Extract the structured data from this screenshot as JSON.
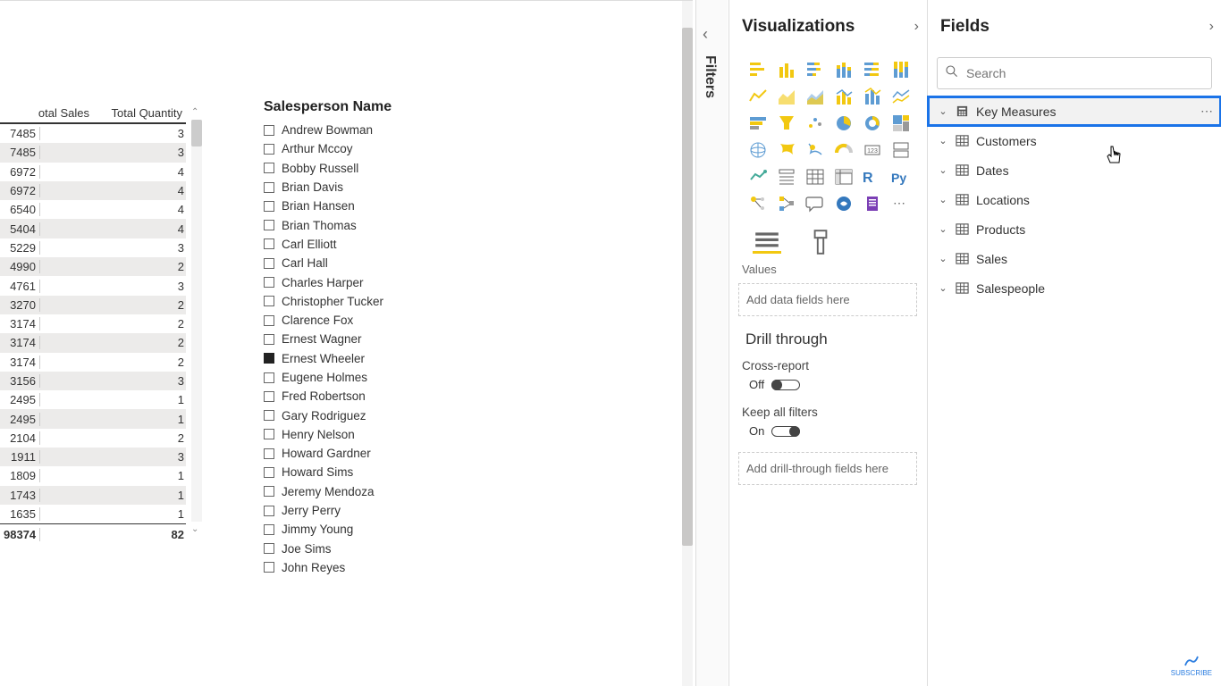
{
  "table": {
    "headers": {
      "sales": "otal Sales",
      "qty": "Total Quantity"
    },
    "rows": [
      {
        "sales": "7485",
        "qty": "3"
      },
      {
        "sales": "7485",
        "qty": "3"
      },
      {
        "sales": "6972",
        "qty": "4"
      },
      {
        "sales": "6972",
        "qty": "4"
      },
      {
        "sales": "6540",
        "qty": "4"
      },
      {
        "sales": "5404",
        "qty": "4"
      },
      {
        "sales": "5229",
        "qty": "3"
      },
      {
        "sales": "4990",
        "qty": "2"
      },
      {
        "sales": "4761",
        "qty": "3"
      },
      {
        "sales": "3270",
        "qty": "2"
      },
      {
        "sales": "3174",
        "qty": "2"
      },
      {
        "sales": "3174",
        "qty": "2"
      },
      {
        "sales": "3174",
        "qty": "2"
      },
      {
        "sales": "3156",
        "qty": "3"
      },
      {
        "sales": "2495",
        "qty": "1"
      },
      {
        "sales": "2495",
        "qty": "1"
      },
      {
        "sales": "2104",
        "qty": "2"
      },
      {
        "sales": "1911",
        "qty": "3"
      },
      {
        "sales": "1809",
        "qty": "1"
      },
      {
        "sales": "1743",
        "qty": "1"
      },
      {
        "sales": "1635",
        "qty": "1"
      }
    ],
    "totals": {
      "sales": "98374",
      "qty": "82"
    }
  },
  "slicer": {
    "title": "Salesperson Name",
    "items": [
      {
        "label": "Andrew Bowman",
        "checked": false
      },
      {
        "label": "Arthur Mccoy",
        "checked": false
      },
      {
        "label": "Bobby Russell",
        "checked": false
      },
      {
        "label": "Brian Davis",
        "checked": false
      },
      {
        "label": "Brian Hansen",
        "checked": false
      },
      {
        "label": "Brian Thomas",
        "checked": false
      },
      {
        "label": "Carl Elliott",
        "checked": false
      },
      {
        "label": "Carl Hall",
        "checked": false
      },
      {
        "label": "Charles Harper",
        "checked": false
      },
      {
        "label": "Christopher Tucker",
        "checked": false
      },
      {
        "label": "Clarence Fox",
        "checked": false
      },
      {
        "label": "Ernest Wagner",
        "checked": false
      },
      {
        "label": "Ernest Wheeler",
        "checked": true
      },
      {
        "label": "Eugene Holmes",
        "checked": false
      },
      {
        "label": "Fred Robertson",
        "checked": false
      },
      {
        "label": "Gary Rodriguez",
        "checked": false
      },
      {
        "label": "Henry Nelson",
        "checked": false
      },
      {
        "label": "Howard Gardner",
        "checked": false
      },
      {
        "label": "Howard Sims",
        "checked": false
      },
      {
        "label": "Jeremy Mendoza",
        "checked": false
      },
      {
        "label": "Jerry Perry",
        "checked": false
      },
      {
        "label": "Jimmy Young",
        "checked": false
      },
      {
        "label": "Joe Sims",
        "checked": false
      },
      {
        "label": "John Reyes",
        "checked": false
      }
    ]
  },
  "filters": {
    "label": "Filters"
  },
  "viz": {
    "title": "Visualizations",
    "values_label": "Values",
    "values_placeholder": "Add data fields here",
    "drill_title": "Drill through",
    "cross_report": "Cross-report",
    "off": "Off",
    "keep_all": "Keep all filters",
    "on": "On",
    "drill_placeholder": "Add drill-through fields here"
  },
  "fields": {
    "title": "Fields",
    "search_placeholder": "Search",
    "tables": [
      {
        "name": "Key Measures",
        "icon": "measures",
        "selected": true,
        "more": true
      },
      {
        "name": "Customers",
        "icon": "table"
      },
      {
        "name": "Dates",
        "icon": "table"
      },
      {
        "name": "Locations",
        "icon": "table"
      },
      {
        "name": "Products",
        "icon": "table"
      },
      {
        "name": "Sales",
        "icon": "table"
      },
      {
        "name": "Salespeople",
        "icon": "table"
      }
    ]
  },
  "subscribe": "SUBSCRIBE"
}
